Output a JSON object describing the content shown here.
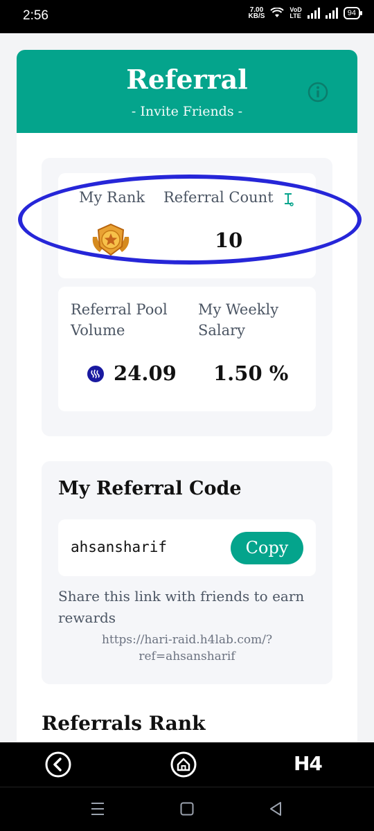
{
  "status_bar": {
    "time": "2:56",
    "speed_value": "7.00",
    "speed_unit": "KB/S",
    "volte_top": "VoD",
    "volte_bottom": "LTE",
    "battery": "94"
  },
  "header": {
    "title": "Referral",
    "subtitle": "- Invite Friends -"
  },
  "stats": {
    "rank_label": "My Rank",
    "count_label": "Referral Count",
    "count_value": "10",
    "pool_label_line1": "Referral Pool",
    "pool_label_line2": "Volume",
    "salary_label_line1": "My Weekly",
    "salary_label_line2": "Salary",
    "pool_value": "24.09",
    "salary_value": "1.50 %"
  },
  "referral_code": {
    "title": "My Referral Code",
    "code": "ahsansharif",
    "copy_label": "Copy",
    "share_text": "Share this link with friends to earn rewards",
    "link_line1": "https://hari-raid.h4lab.com/?",
    "link_line2": "ref=ahsansharif"
  },
  "ranks_section": {
    "title": "Referrals Rank"
  },
  "bottom_nav": {
    "logo": "H4"
  },
  "colors": {
    "accent": "#04a48c",
    "highlight": "#2626d8",
    "steem": "#1a1aa0"
  },
  "icons": {
    "rank_badge": "rank-badge-icon",
    "info": "info-icon",
    "steem": "steem-icon",
    "back": "back-icon",
    "home": "home-icon"
  }
}
